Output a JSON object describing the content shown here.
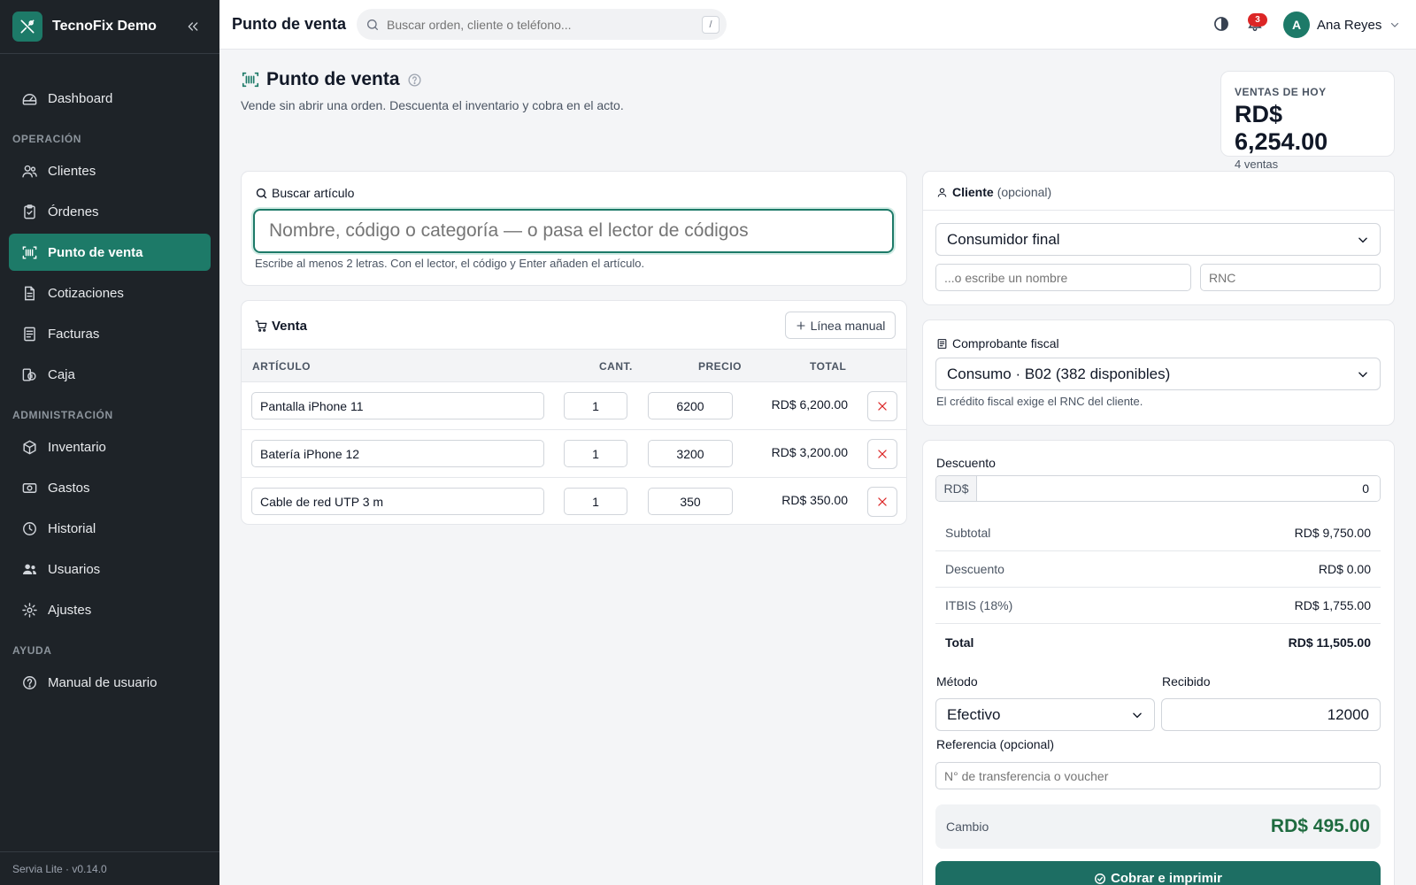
{
  "brand": {
    "name": "TecnoFix Demo"
  },
  "sidebar": {
    "items_top": [
      {
        "label": "Dashboard",
        "icon": "dashboard-icon"
      }
    ],
    "sections": [
      {
        "title": "OPERACIÓN",
        "items": [
          {
            "label": "Clientes",
            "icon": "users-icon"
          },
          {
            "label": "Órdenes",
            "icon": "clipboard-icon"
          },
          {
            "label": "Punto de venta",
            "icon": "barcode-icon",
            "active": true
          },
          {
            "label": "Cotizaciones",
            "icon": "document-icon"
          },
          {
            "label": "Facturas",
            "icon": "receipt-icon"
          },
          {
            "label": "Caja",
            "icon": "cash-register-icon"
          }
        ]
      },
      {
        "title": "ADMINISTRACIÓN",
        "items": [
          {
            "label": "Inventario",
            "icon": "box-icon"
          },
          {
            "label": "Gastos",
            "icon": "banknote-icon"
          },
          {
            "label": "Historial",
            "icon": "clock-icon"
          },
          {
            "label": "Usuarios",
            "icon": "user-group-icon"
          },
          {
            "label": "Ajustes",
            "icon": "gear-icon"
          }
        ]
      },
      {
        "title": "AYUDA",
        "items": [
          {
            "label": "Manual de usuario",
            "icon": "help-circle-icon"
          }
        ]
      }
    ],
    "footer": "Servia Lite · v0.14.0"
  },
  "topbar": {
    "title": "Punto de venta",
    "search_placeholder": "Buscar orden, cliente o teléfono...",
    "shortcut": "/",
    "notifications": "3",
    "user_initial": "A",
    "user_name": "Ana Reyes"
  },
  "page": {
    "title": "Punto de venta",
    "subtitle": "Vende sin abrir una orden. Descuenta el inventario y cobra en el acto."
  },
  "kpi": {
    "label": "VENTAS DE HOY",
    "value": "RD$ 6,254.00",
    "sub": "4 ventas"
  },
  "search_card": {
    "label": "Buscar artículo",
    "placeholder": "Nombre, código o categoría — o pasa el lector de códigos",
    "hint": "Escribe al menos 2 letras. Con el lector, el código y Enter añaden el artículo."
  },
  "sale": {
    "title": "Venta",
    "manual_button": "Línea manual",
    "columns": {
      "item": "ARTÍCULO",
      "qty": "CANT.",
      "price": "PRECIO",
      "total": "TOTAL"
    },
    "rows": [
      {
        "item": "Pantalla iPhone 11",
        "qty": "1",
        "price": "6200",
        "total": "RD$ 6,200.00"
      },
      {
        "item": "Batería iPhone 12",
        "qty": "1",
        "price": "3200",
        "total": "RD$ 3,200.00"
      },
      {
        "item": "Cable de red UTP 3 m",
        "qty": "1",
        "price": "350",
        "total": "RD$ 350.00"
      }
    ]
  },
  "client": {
    "title": "Cliente",
    "optional": "(opcional)",
    "selected": "Consumidor final",
    "name_placeholder": "...o escribe un nombre",
    "rnc_placeholder": "RNC"
  },
  "fiscal": {
    "title": "Comprobante fiscal",
    "selected": "Consumo · B02 (382 disponibles)",
    "hint": "El crédito fiscal exige el RNC del cliente."
  },
  "payment": {
    "discount_label": "Descuento",
    "currency": "RD$",
    "discount_value": "0",
    "summary": {
      "subtotal_label": "Subtotal",
      "subtotal": "RD$ 9,750.00",
      "discount_label": "Descuento",
      "discount": "RD$ 0.00",
      "tax_label": "ITBIS (18%)",
      "tax": "RD$ 1,755.00",
      "total_label": "Total",
      "total": "RD$ 11,505.00"
    },
    "method_label": "Método",
    "method": "Efectivo",
    "received_label": "Recibido",
    "received": "12000",
    "reference_label": "Referencia (opcional)",
    "reference_placeholder": "N° de transferencia o voucher",
    "change_label": "Cambio",
    "change": "RD$ 495.00",
    "pay_button": "Cobrar e imprimir"
  },
  "colors": {
    "brand": "#1d7a68",
    "sidebar": "#1e2328",
    "accent_button": "#1d6e63",
    "change_text": "#1e6b3f",
    "badge": "#dc2626"
  }
}
